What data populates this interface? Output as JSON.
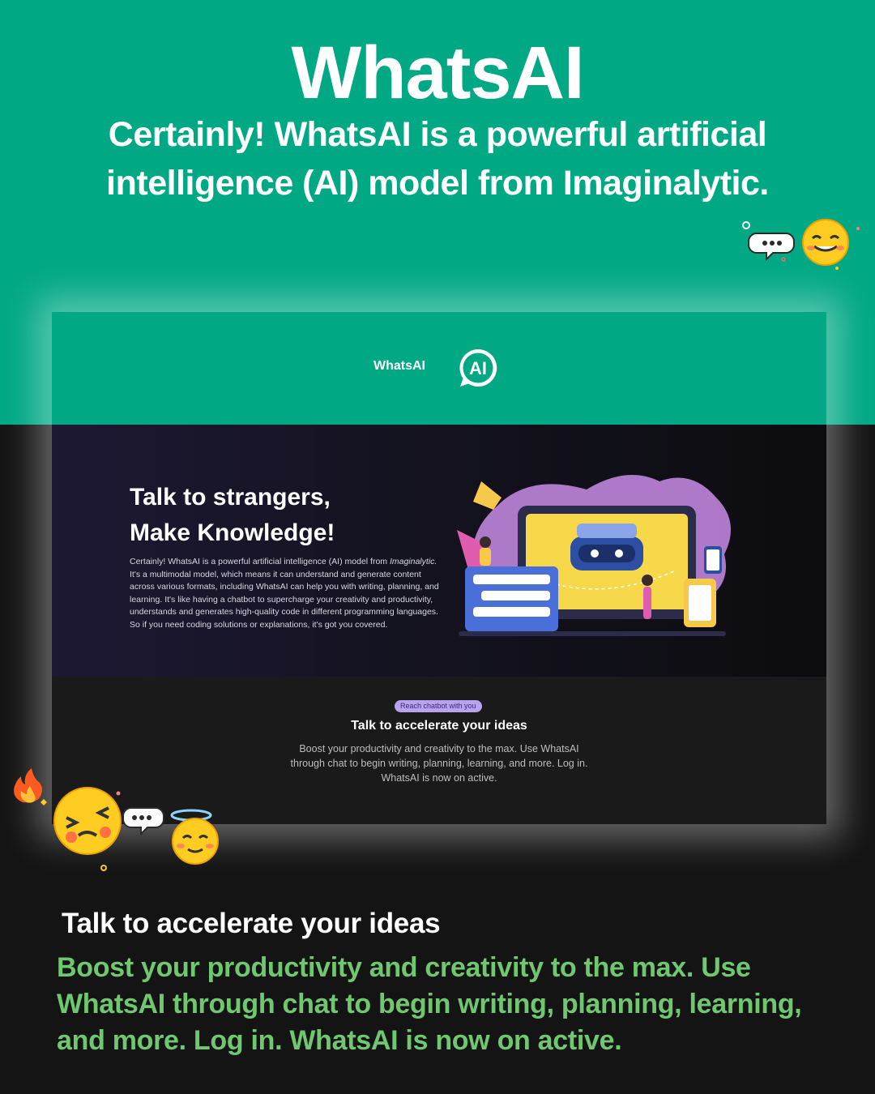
{
  "promo": {
    "title": "WhatsAI",
    "subtitle": "Certainly! WhatsAI is a powerful artificial intelligence (AI) model from Imaginalytic."
  },
  "site": {
    "brand": "WhatsAI",
    "logo_text": "AI",
    "hero": {
      "title_line1": "Talk to strangers,",
      "title_line2": "Make Knowledge!",
      "text_before_italic": "Certainly! WhatsAI is a powerful artificial intelligence (AI) model from ",
      "text_italic": "Imaginalytic.",
      "text_after_italic": " It's a multimodal model, which means it can understand and generate content across various formats, including WhatsAI can help you with writing, planning, and learning. It's like having a chatbot to supercharge your creativity and productivity, understands and generates high-quality code in different programming languages. So if you need coding solutions or explanations, it's got you covered."
    },
    "section": {
      "badge": "Reach chatbot with you",
      "title": "Talk to accelerate your ideas",
      "text": "Boost your productivity and creativity to the max. Use WhatsAI through chat to begin writing, planning, learning, and more. Log in. WhatsAI is now on active."
    }
  },
  "cta": {
    "title": "Talk to accelerate your ideas",
    "text": "Boost your productivity and creativity to the max. Use WhatsAI through chat to begin writing, planning, learning, and more. Log in. WhatsAI is now on active."
  },
  "colors": {
    "brand_green": "#00a884",
    "highlight_green": "#6fc86f",
    "badge_purple": "#b9a3f0"
  },
  "icons": [
    "chat-bubble-icon",
    "grinning-emoji-icon",
    "fire-emoji-icon",
    "angry-emoji-icon",
    "angel-emoji-icon",
    "robot-illustration"
  ]
}
